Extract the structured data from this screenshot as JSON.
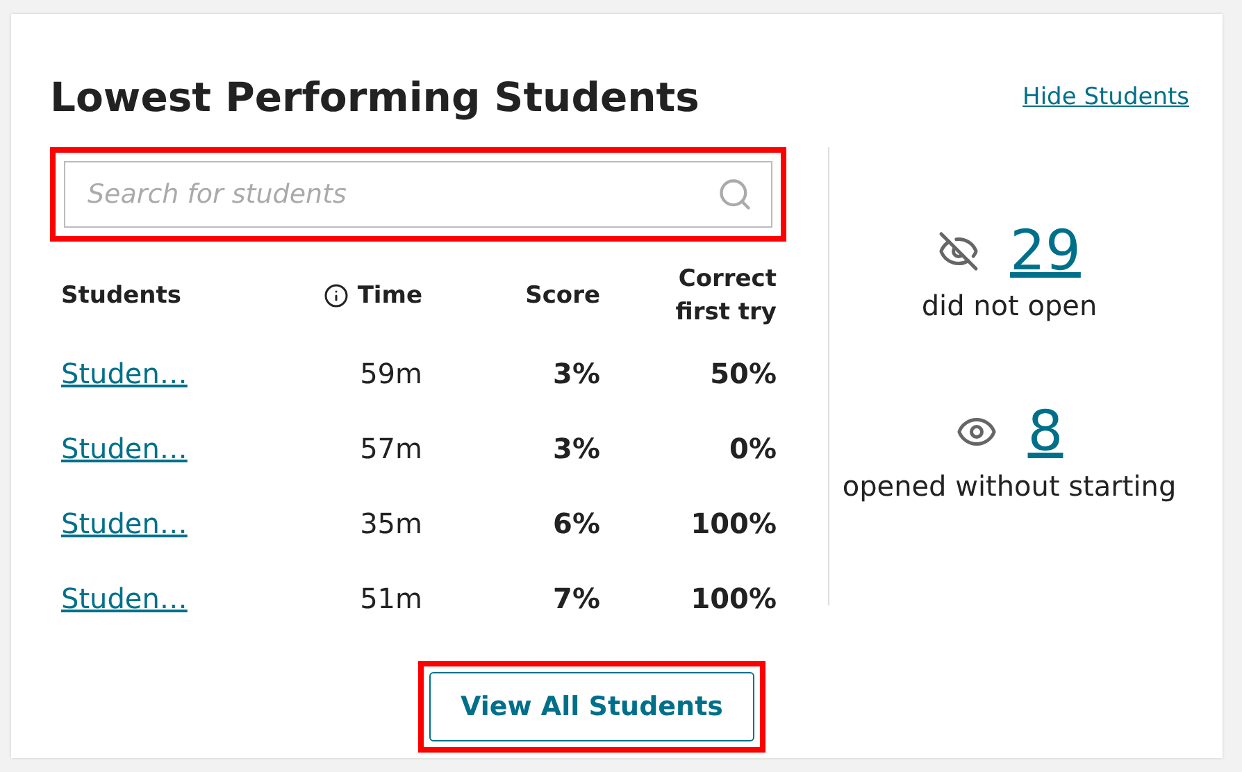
{
  "title": "Lowest Performing Students",
  "hide_link": "Hide Students",
  "search": {
    "placeholder": "Search for students",
    "highlighted": true
  },
  "table": {
    "columns": [
      {
        "label": "Students",
        "info": false
      },
      {
        "label": "Time",
        "info": true
      },
      {
        "label": "Score",
        "info": false
      },
      {
        "label": "Correct first try",
        "info": false
      }
    ],
    "rows": [
      {
        "name": "Studen…",
        "time": "59m",
        "score": "3%",
        "correct": "50%"
      },
      {
        "name": "Studen…",
        "time": "57m",
        "score": "3%",
        "correct": "0%"
      },
      {
        "name": "Studen…",
        "time": "35m",
        "score": "6%",
        "correct": "100%"
      },
      {
        "name": "Studen…",
        "time": "51m",
        "score": "7%",
        "correct": "100%"
      }
    ]
  },
  "stats": [
    {
      "kind": "hidden",
      "count": "29",
      "label": "did not open"
    },
    {
      "kind": "visible",
      "count": "8",
      "label": "opened without starting"
    }
  ],
  "button": {
    "label": "View All Students",
    "highlighted": true
  }
}
